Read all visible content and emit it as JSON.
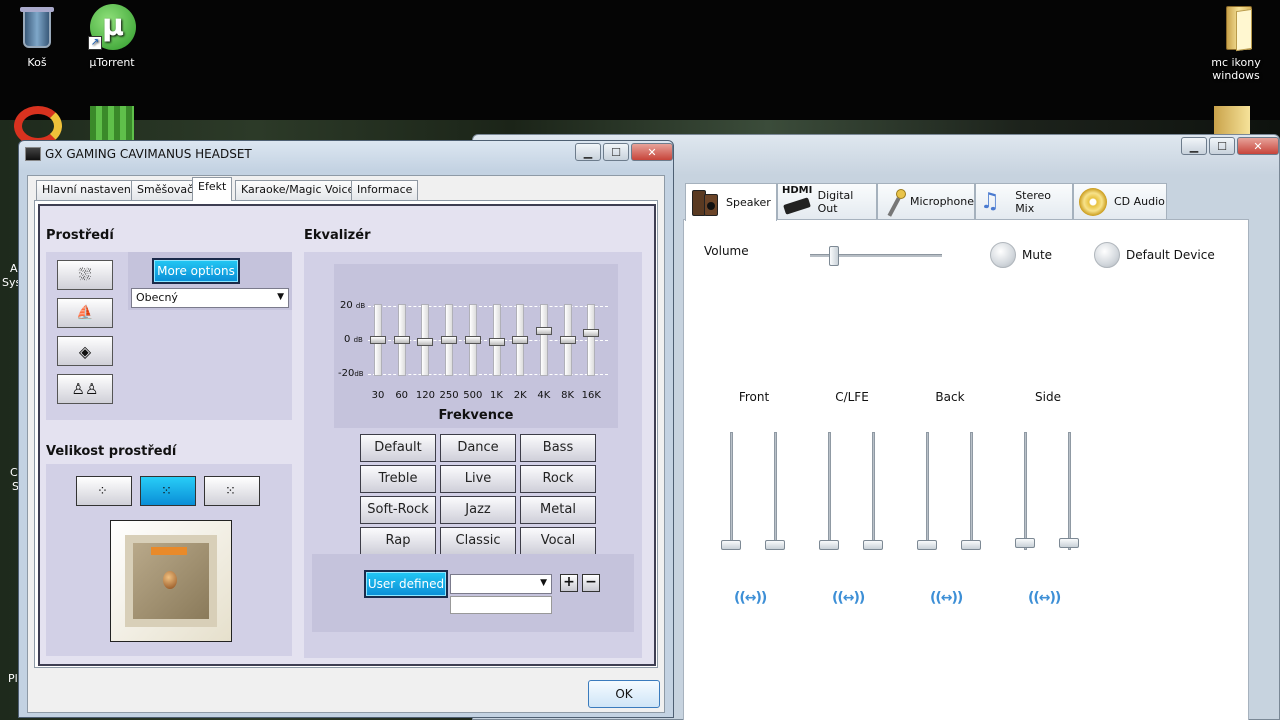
{
  "desktop": {
    "icons": [
      {
        "label": "Koš"
      },
      {
        "label": "µTorrent"
      },
      {
        "label": "mc ikony windows"
      }
    ],
    "partial_labels": [
      "A",
      "Sys",
      "C",
      "S",
      "Pl"
    ]
  },
  "right_window": {
    "tabs": [
      {
        "label": "Speaker",
        "icon": "speaker-icon"
      },
      {
        "label": "Digital Out",
        "icon": "hdmi-icon",
        "badge": "HDMI"
      },
      {
        "label": "Microphone",
        "icon": "microphone-icon"
      },
      {
        "label": "Stereo Mix",
        "icon": "music-notes-icon"
      },
      {
        "label": "CD Audio",
        "icon": "cd-icon"
      }
    ],
    "volume_label": "Volume",
    "volume_level": 0.18,
    "mute_label": "Mute",
    "default_device_label": "Default Device",
    "channels": [
      {
        "label": "Front",
        "balance": "((↔))"
      },
      {
        "label": "C/LFE",
        "balance": "((↔))"
      },
      {
        "label": "Back",
        "balance": "((↔))"
      },
      {
        "label": "Side",
        "balance": "((↔))"
      }
    ]
  },
  "dialog": {
    "title": "GX GAMING CAVIMANUS HEADSET",
    "tabs": [
      "Hlavní nastavení",
      "Směšovač",
      "Efekt",
      "Karaoke/Magic Voice",
      "Informace"
    ],
    "active_tab": "Efekt",
    "environment": {
      "heading": "Prostředí",
      "more_options": "More options",
      "selected": "Obecný"
    },
    "room_size": {
      "heading": "Velikost prostředí"
    },
    "equalizer": {
      "heading": "Ekvalizér",
      "db_labels": [
        "20",
        "0",
        "-20"
      ],
      "db_unit": "dB",
      "bands": [
        "30",
        "60",
        "120",
        "250",
        "500",
        "1K",
        "2K",
        "4K",
        "8K",
        "16K"
      ],
      "band_values_db": [
        0,
        0,
        -1,
        0,
        0,
        -1,
        0,
        5,
        0,
        4
      ],
      "xlabel": "Frekvence",
      "presets": [
        "Default",
        "Dance",
        "Bass",
        "Treble",
        "Live",
        "Rock",
        "Soft-Rock",
        "Jazz",
        "Metal",
        "Rap",
        "Classic",
        "Vocal"
      ],
      "user_defined": "User defined",
      "add": "+",
      "remove": "−"
    },
    "ok_label": "OK",
    "colors": {
      "accent": "#0a8dd6",
      "panel": "#d2d0e6",
      "frame": "#3e3e52"
    }
  }
}
